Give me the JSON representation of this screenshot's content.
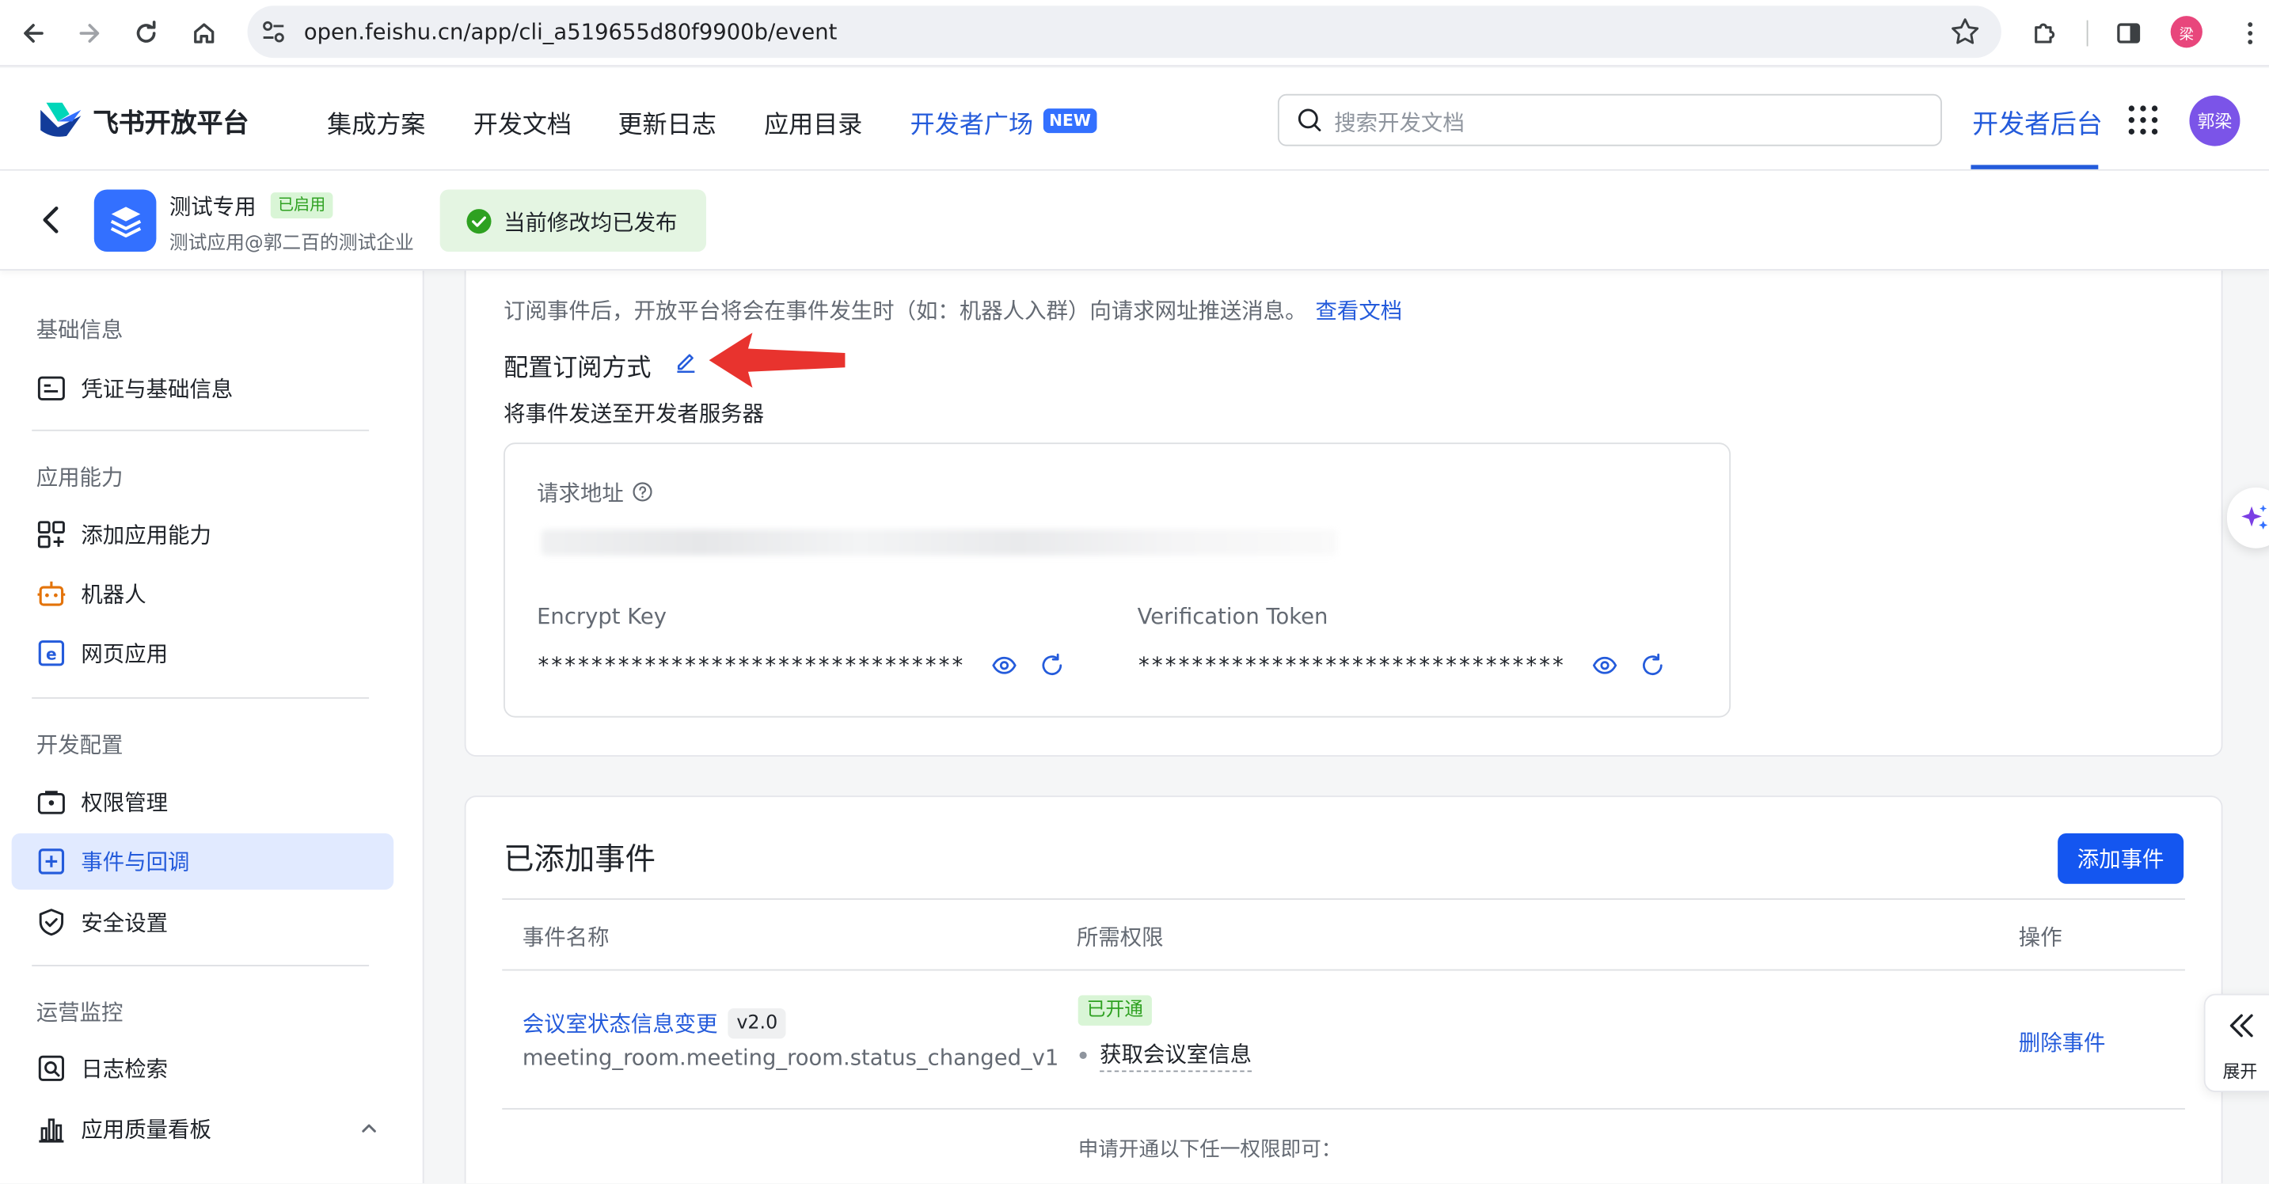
{
  "browser": {
    "url": "open.feishu.cn/app/cli_a519655d80f9900b/event",
    "profile_initial": "梁"
  },
  "topnav": {
    "brand": "飞书开放平台",
    "items": [
      "集成方案",
      "开发文档",
      "更新日志",
      "应用目录",
      "开发者广场"
    ],
    "new_badge": "NEW",
    "search_placeholder": "搜索开发文档",
    "console": "开发者后台",
    "avatar_text": "郭梁",
    "accent_color": "#245bdb"
  },
  "appbar": {
    "app_name": "测试专用",
    "status_badge": "已启用",
    "app_sub": "测试应用@郭二百的测试企业",
    "toast": "当前修改均已发布"
  },
  "sidebar": {
    "sections": [
      "基础信息",
      "应用能力",
      "开发配置",
      "运营监控"
    ],
    "items": [
      {
        "label": "凭证与基础信息",
        "icon": "id-card-icon"
      },
      {
        "label": "添加应用能力",
        "icon": "apps-add-icon"
      },
      {
        "label": "机器人",
        "icon": "robot-icon"
      },
      {
        "label": "网页应用",
        "icon": "web-app-icon"
      },
      {
        "label": "权限管理",
        "icon": "permission-icon"
      },
      {
        "label": "事件与回调",
        "icon": "event-icon"
      },
      {
        "label": "安全设置",
        "icon": "shield-icon"
      },
      {
        "label": "日志检索",
        "icon": "log-search-icon"
      },
      {
        "label": "应用质量看板",
        "icon": "chart-icon"
      }
    ],
    "active": "事件与回调"
  },
  "subscription": {
    "desc": "订阅事件后，开放平台将会在事件发生时（如：机器人入群）向请求网址推送消息。",
    "doc_link": "查看文档",
    "config_title": "配置订阅方式",
    "send_title": "将事件发送至开发者服务器",
    "request_url_label": "请求地址",
    "encrypt_key_label": "Encrypt Key",
    "encrypt_key_value": "********************************",
    "verification_token_label": "Verification Token",
    "verification_token_value": "********************************"
  },
  "events": {
    "title": "已添加事件",
    "add_button": "添加事件",
    "columns": [
      "事件名称",
      "所需权限",
      "操作"
    ],
    "rows": [
      {
        "name": "会议室状态信息变更",
        "version": "v2.0",
        "key": "meeting_room.meeting_room.status_changed_v1",
        "permission_status": "已开通",
        "permission": "获取会议室信息",
        "action": "删除事件"
      }
    ],
    "apply_hint": "申请开通以下任一权限即可："
  },
  "float": {
    "expand_label": "展开"
  }
}
